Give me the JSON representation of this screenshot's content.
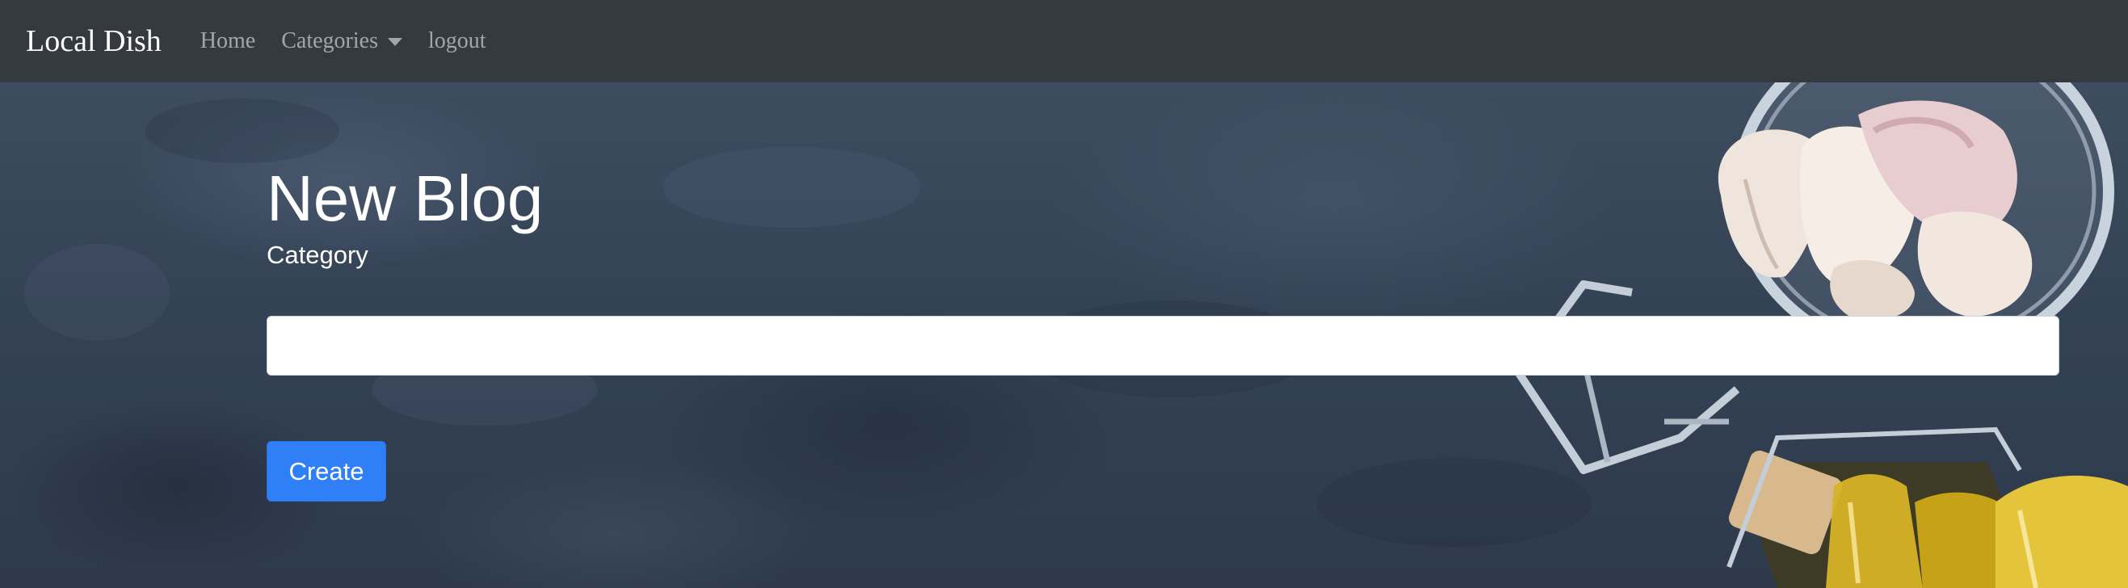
{
  "navbar": {
    "brand": "Local Dish",
    "links": {
      "home": "Home",
      "categories": "Categories",
      "logout": "logout"
    }
  },
  "form": {
    "title": "New Blog",
    "category_label": "Category",
    "category_value": "",
    "create_label": "Create"
  },
  "colors": {
    "navbar_bg": "#343a40",
    "primary_button": "#2f7ff7",
    "background_slate": "#3a4658"
  },
  "icons": {
    "categories_dropdown": "caret-down-icon"
  }
}
